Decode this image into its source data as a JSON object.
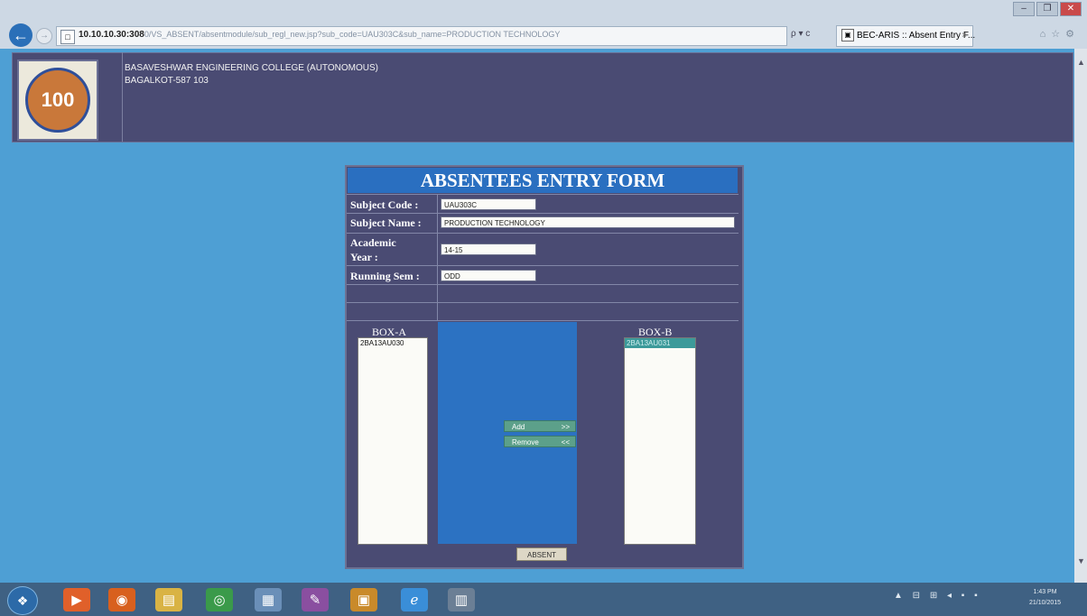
{
  "browser": {
    "address_host": "10.10.10.30:308",
    "address_path": "0/VS_ABSENT/absentmodule/sub_regl_new.jsp?sub_code=UAU303C&sub_name=PRODUCTION TECHNOLOGY",
    "search_controls": "ρ ▾ c",
    "tab_title": "BEC-ARIS :: Absent Entry F...",
    "tab_close": "×",
    "tools": "⌂☆⚙",
    "win_controls": [
      "–",
      "❐",
      "✕"
    ]
  },
  "header": {
    "logo_text": "100",
    "college_name": "BASAVESHWAR ENGINEERING COLLEGE (AUTONOMOUS)",
    "college_address": "BAGALKOT-587 103"
  },
  "form": {
    "title": "ABSENTEES ENTRY FORM",
    "subject_code_label": "Subject Code :",
    "subject_code_value": "UAU303C",
    "subject_name_label": "Subject Name :",
    "subject_name_value": "PRODUCTION TECHNOLOGY",
    "academic_year_label_1": "Academic",
    "academic_year_label_2": "Year :",
    "academic_year_value": "14-15",
    "running_sem_label": "Running Sem :",
    "running_sem_value": "ODD",
    "box_a_label": "BOX-A",
    "box_b_label": "BOX-B",
    "box_a_items": [
      "2BA13AU030"
    ],
    "box_b_items": [
      "2BA13AU031"
    ],
    "add_label": "Add",
    "add_arrow": ">>",
    "remove_label": "Remove",
    "remove_arrow": "<<",
    "absent_label": "ABSENT"
  },
  "taskbar": {
    "start_glyph": "❖",
    "apps": [
      {
        "name": "media-player-icon",
        "glyph": "▶",
        "color": "#e0602a"
      },
      {
        "name": "firefox-icon",
        "glyph": "◉",
        "color": "#d8601e"
      },
      {
        "name": "file-explorer-icon",
        "glyph": "▤",
        "color": "#d9b344"
      },
      {
        "name": "chrome-icon",
        "glyph": "◎",
        "color": "#3a9a4a"
      },
      {
        "name": "network-icon",
        "glyph": "▦",
        "color": "#6a8fb8"
      },
      {
        "name": "paint-icon",
        "glyph": "✎",
        "color": "#8a4fa0"
      },
      {
        "name": "windows-folders-icon",
        "glyph": "▣",
        "color": "#c98a2a"
      },
      {
        "name": "internet-explorer-icon",
        "glyph": "ℯ",
        "color": "#3a8ed8"
      },
      {
        "name": "calculator-icon",
        "glyph": "▥",
        "color": "#6b7f95"
      }
    ],
    "tray": "▲ ⊟ ⊞ ◂ ▪ ▪",
    "clock_time": "1:43 PM",
    "clock_date": "21/10/2015"
  }
}
